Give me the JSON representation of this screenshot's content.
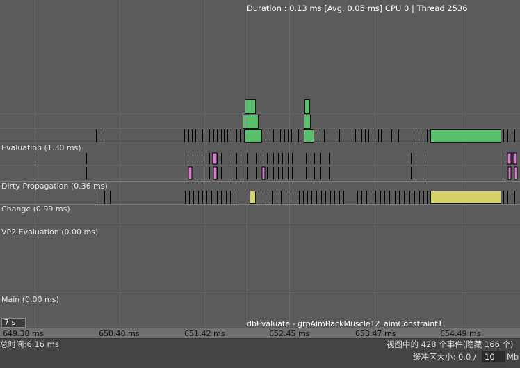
{
  "header": {
    "duration_info": "Duration : 0.13 ms [Avg. 0.05 ms] CPU 0 | Thread 2536"
  },
  "categories": [
    {
      "label": "Evaluation (1.30 ms)"
    },
    {
      "label": "Dirty Propagation (0.36 ms)"
    },
    {
      "label": "Change (0.99 ms)"
    },
    {
      "label": "VP2 Evaluation (0.00 ms)"
    },
    {
      "label": "Main (0.00 ms)"
    }
  ],
  "selected_event": {
    "name": "dbEvaluate - grpAimBackMuscle12_aimConstraint1"
  },
  "time_window": {
    "label": "7 s"
  },
  "ruler": {
    "ticks": [
      "649.38 ms",
      "650.40 ms",
      "651.42 ms",
      "652.45 ms",
      "653.47 ms",
      "654.49 ms"
    ]
  },
  "status_bar": {
    "total_time": "总时间:6.16 ms",
    "events_in_view": "视图中的 428 个事件(隐藏 166 个)",
    "buffer_label": "缓冲区大小: 0.0 /",
    "buffer_value": "10",
    "buffer_unit": "Mb"
  },
  "colors": {
    "background": "#5b5b5b",
    "evaluation_event": "#5bc06e",
    "dirty_event": "#d6d26a",
    "highlight_event": "#d97bd0",
    "cursor_line": "#ffffff"
  }
}
